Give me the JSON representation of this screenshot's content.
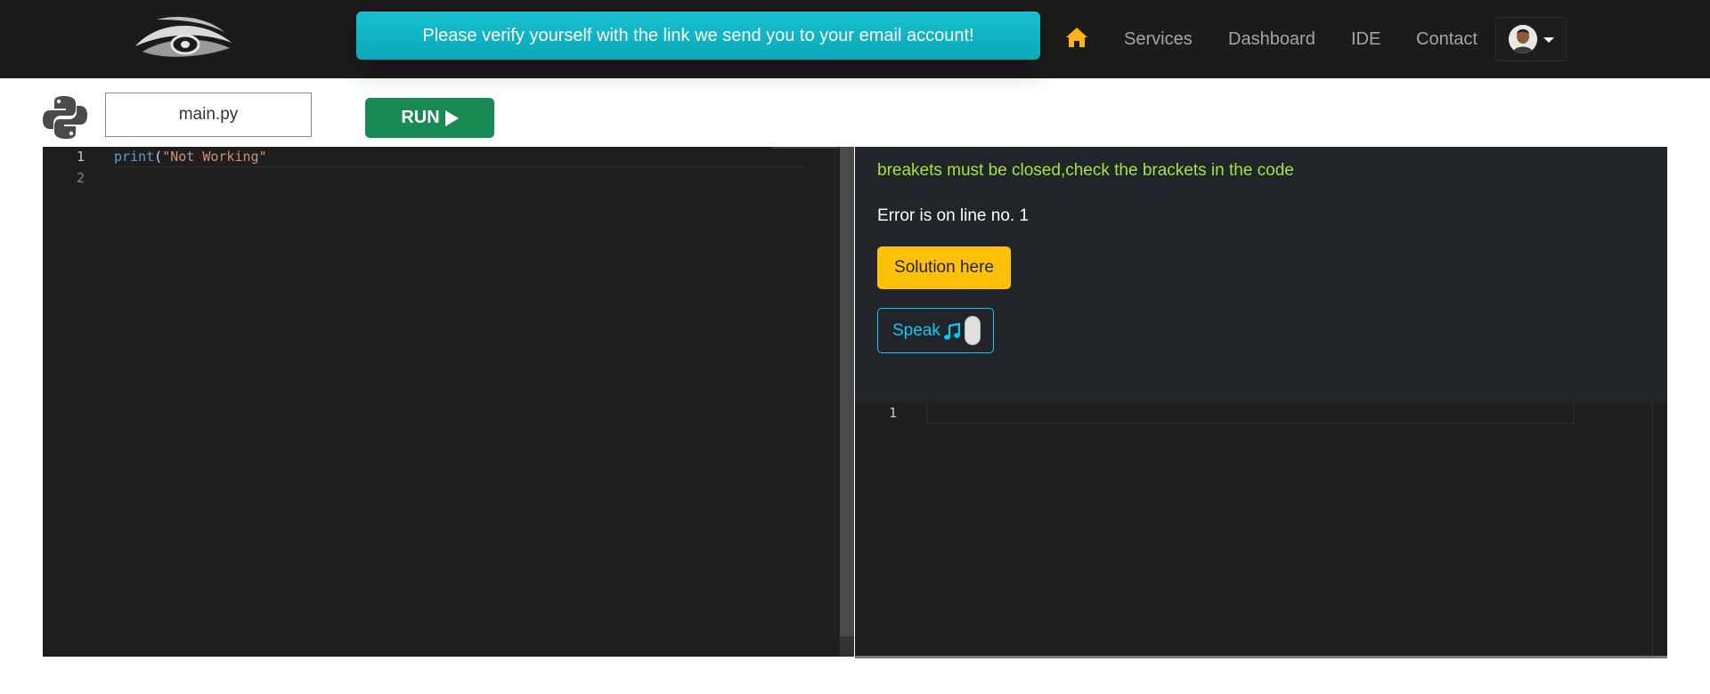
{
  "navbar": {
    "logo_icon": "eye-logo-icon",
    "notification": "Please verify yourself with the link we send you to your email account!",
    "home_icon": "home-icon",
    "links": [
      "Services",
      "Dashboard",
      "IDE",
      "Contact"
    ],
    "user_icon": "avatar",
    "accent_color": "#fcb517"
  },
  "toolbar": {
    "language_icon": "python-logo-icon",
    "filename": "main.py",
    "run_label": "RUN",
    "run_color": "#1a8a55"
  },
  "editor": {
    "line_numbers": [
      "1",
      "2"
    ],
    "code": {
      "fn": "print",
      "open": "(",
      "str": "\"Not Working\""
    }
  },
  "output": {
    "error_message": "breakets must be closed,check the brackets in the code",
    "error_line": "Error is on line no. 1",
    "solution_label": "Solution here",
    "speak_label": "Speak"
  },
  "editor2": {
    "line_numbers": [
      "1"
    ]
  }
}
